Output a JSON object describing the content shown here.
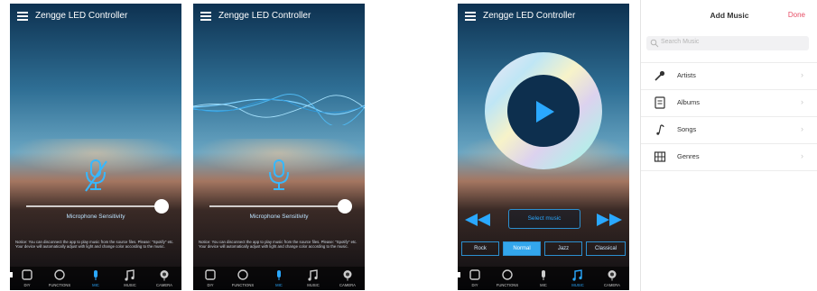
{
  "app": {
    "title": "Zengge LED Controller"
  },
  "mic_screen": {
    "sensitivity_label": "Microphone Sensitivity",
    "note": "Notice: You can disconnect the app to play music from the source files. Please: \"Spotify\" etc. Your device will automatically adjust with light and change color according to the music.",
    "sensitivity_level": 0.93
  },
  "tabs": [
    "DIY",
    "FUNCTIONS",
    "MIC",
    "MUSIC",
    "CAMERA"
  ],
  "music_screen": {
    "select_label": "Select music",
    "modes": [
      "Rock",
      "Normal",
      "Jazz",
      "Classical"
    ],
    "active_mode": "Normal"
  },
  "add_music": {
    "title": "Add Music",
    "done_label": "Done",
    "search_placeholder": "Search Music",
    "items": [
      {
        "label": "Artists",
        "icon": "microphone-icon"
      },
      {
        "label": "Albums",
        "icon": "album-icon"
      },
      {
        "label": "Songs",
        "icon": "music-note-icon"
      },
      {
        "label": "Genres",
        "icon": "piano-icon"
      }
    ]
  },
  "colors": {
    "accent": "#2aa8ff",
    "done": "#e74c64"
  }
}
